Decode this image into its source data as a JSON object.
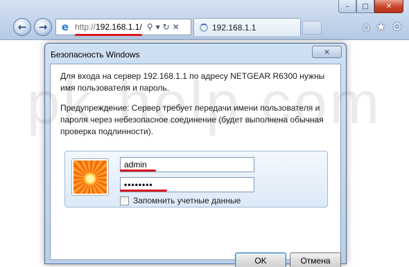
{
  "browser": {
    "window_controls": {
      "minimize": "–",
      "maximize": "□",
      "close": "✕"
    },
    "nav": {
      "back_icon": "←",
      "forward_icon": "→"
    },
    "address": {
      "protocol": "http://",
      "host": "192.168.1.1/",
      "search_icon": "⚲",
      "dropdown_icon": "▾",
      "refresh_icon": "↻",
      "stop_icon": "✕"
    },
    "tab": {
      "label": "192.168.1.1"
    },
    "toolbar": {
      "home_icon": "⌂",
      "favorites_icon": "★",
      "tools_icon": "⚙"
    }
  },
  "watermark": "pk-help.com",
  "dialog": {
    "title": "Безопасность Windows",
    "close_icon": "✕",
    "message": "Для входа на сервер 192.168.1.1 по адресу NETGEAR R6300 нужны имя пользователя и пароль.",
    "warning": "Предупреждение: Сервер требует передачи имени пользователя и пароля через небезопасное соединение (будет выполнена обычная проверка подлинности).",
    "username": "admin",
    "password_mask": "••••••••",
    "remember_label": "Запомнить учетные данные",
    "remember_checked": false,
    "ok_label": "OK",
    "cancel_label": "Отмена"
  },
  "colors": {
    "highlight": "#e0161e",
    "chrome": "#c0d3ea"
  }
}
